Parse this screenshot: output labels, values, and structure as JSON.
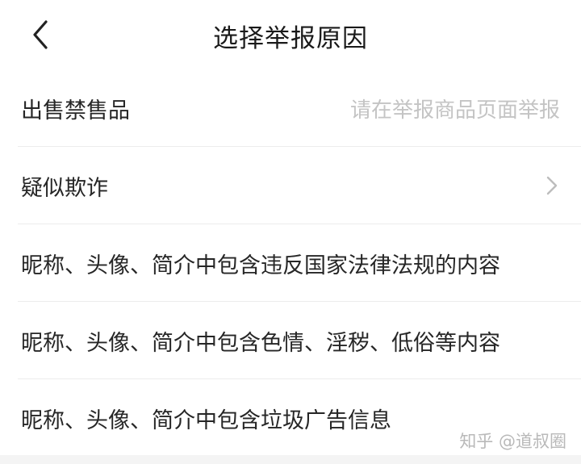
{
  "header": {
    "title": "选择举报原因",
    "back_icon": "chevron-left-icon"
  },
  "reasons": [
    {
      "label": "出售禁售品",
      "hint": "请在举报商品页面举报"
    },
    {
      "label": "疑似欺诈",
      "icon": "chevron-right-icon"
    },
    {
      "label": "昵称、头像、简介中包含违反国家法律法规的内容"
    },
    {
      "label": "昵称、头像、简介中包含色情、淫秽、低俗等内容"
    },
    {
      "label": "昵称、头像、简介中包含垃圾广告信息"
    }
  ],
  "watermark": "知乎 @道叔圈",
  "colors": {
    "background": "#ffffff",
    "text": "#262626",
    "hint": "#c4c4c4",
    "divider": "#ececec"
  }
}
